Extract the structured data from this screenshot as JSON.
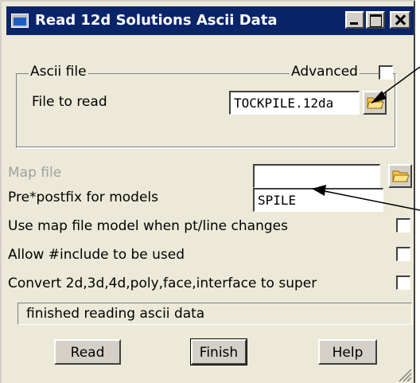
{
  "window": {
    "title": "Read 12d Solutions Ascii Data"
  },
  "group": {
    "legend": "Ascii file",
    "advanced_label": "Advanced",
    "advanced_checked": false,
    "file_label": "File to read",
    "file_value": "TOCKPILE.12da"
  },
  "map_file": {
    "label": "Map file",
    "value": ""
  },
  "prefix": {
    "label": "Pre*postfix for models",
    "value": "SPILE"
  },
  "options": [
    {
      "label": "Use map file model when pt/line changes",
      "checked": false
    },
    {
      "label": "Allow #include to be used",
      "checked": false
    },
    {
      "label": "Convert 2d,3d,4d,poly,face,interface to super",
      "checked": false
    }
  ],
  "status": "finished reading ascii data",
  "buttons": {
    "read": "Read",
    "finish": "Finish",
    "help": "Help"
  },
  "icons": {
    "folder": "folder-open-icon",
    "arrow": "callout-arrow"
  }
}
